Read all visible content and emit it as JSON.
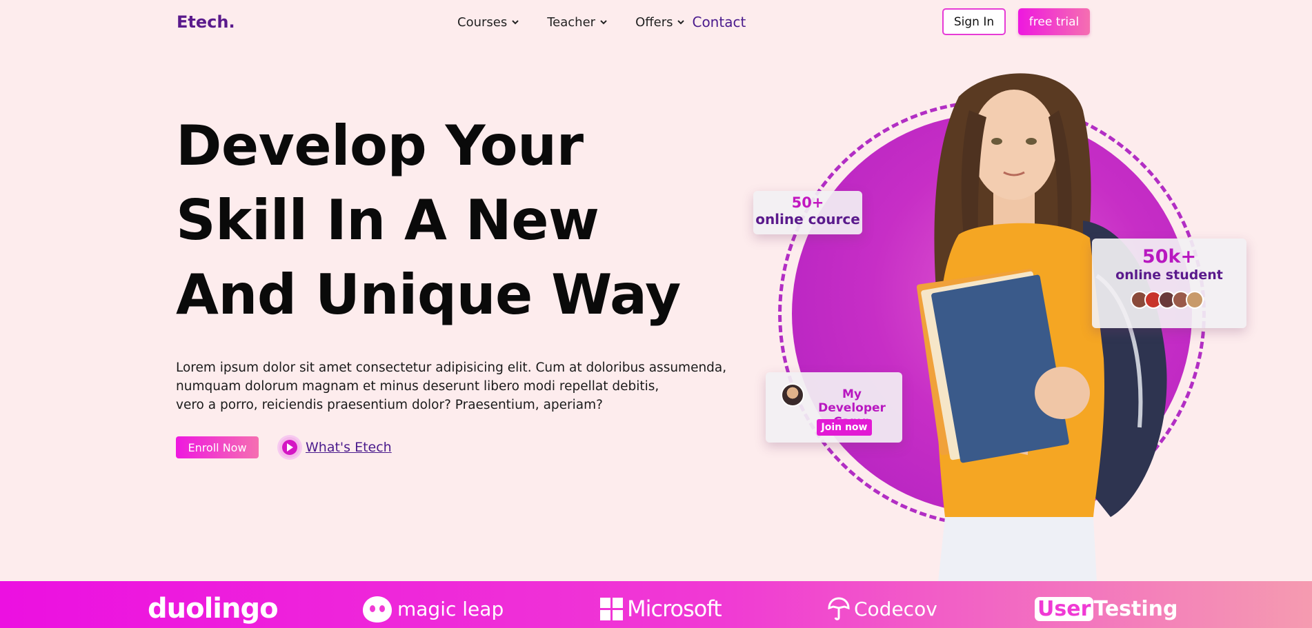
{
  "header": {
    "logo": "Etech.",
    "nav": [
      {
        "label": "Courses"
      },
      {
        "label": "Teacher"
      },
      {
        "label": "Offers"
      }
    ],
    "contact": "Contact",
    "signin": "Sign In",
    "trial": "free trial"
  },
  "hero": {
    "title_lines": [
      "Develop Your",
      "Skill In A New",
      "And Unique Way"
    ],
    "description_lines": [
      "Lorem ipsum dolor sit amet consectetur adipisicing elit. Cum at doloribus assumenda,",
      "numquam dolorum magnam et minus deserunt libero modi repellat debitis,",
      "vero a porro, reiciendis praesentium dolor? Praesentium, aperiam?"
    ],
    "enroll": "Enroll Now",
    "whats": "What's Etech"
  },
  "cards": {
    "courses_count": "50+",
    "courses_label": "online cource",
    "students_count": "50k+",
    "students_label": "online student",
    "camp_title": "My Developer Camp",
    "camp_cta": "Join now"
  },
  "partners": [
    "duolingo",
    "magic leap",
    "Microsoft",
    "Codecov",
    "User",
    "Testing"
  ],
  "colors": {
    "accent": "#ee18df",
    "brand_purple": "#5a1a8c",
    "background": "#fdeced"
  }
}
